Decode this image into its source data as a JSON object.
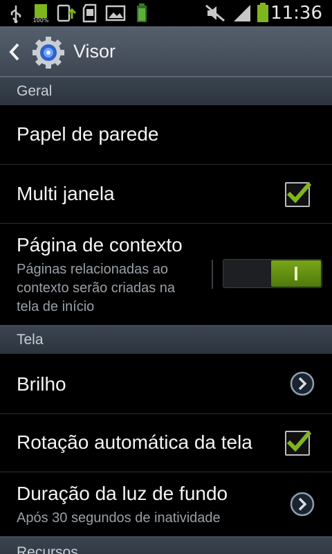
{
  "status_bar": {
    "time": "11:36",
    "battery_small_label": "100%"
  },
  "action_bar": {
    "title": "Visor"
  },
  "sections": {
    "general": "Geral",
    "screen": "Tela",
    "features": "Recursos"
  },
  "items": {
    "wallpaper": {
      "title": "Papel de parede"
    },
    "multi_window": {
      "title": "Multi janela",
      "checked": true
    },
    "context_page": {
      "title": "Página de contexto",
      "summary_line1": "Páginas relacionadas ao",
      "summary_line2": "contexto serão criadas na",
      "summary_line3": "tela de início",
      "enabled": true
    },
    "brightness": {
      "title": "Brilho"
    },
    "auto_rotate": {
      "title": "Rotação automática da tela",
      "checked": true
    },
    "backlight": {
      "title": "Duração da luz de fundo",
      "summary": "Após 30 segundos de inatividade"
    }
  },
  "colors": {
    "accent_green": "#7fb61d",
    "action_bar": "#4a535e",
    "section_header": "#343d48"
  }
}
